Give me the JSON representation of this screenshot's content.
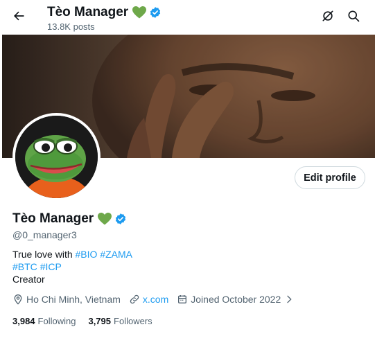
{
  "header": {
    "name": "Tèo Manager",
    "posts_count": "13.8K posts"
  },
  "profile": {
    "display_name": "Tèo Manager",
    "handle": "@0_manager3",
    "edit_label": "Edit profile",
    "bio_prefix": "True love with ",
    "bio_tags_line1": [
      "#BIO",
      "#ZAMA"
    ],
    "bio_tags_line2": [
      "#BTC",
      "#ICP"
    ],
    "bio_last_line": "Creator",
    "location": "Ho Chi Minh, Vietnam",
    "website": "x.com",
    "joined": "Joined October 2022",
    "following_count": "3,984",
    "following_label": "Following",
    "followers_count": "3,795",
    "followers_label": "Followers"
  },
  "colors": {
    "accent": "#1d9bf0",
    "heart": "#6ea84a",
    "secondary_text": "#536471"
  },
  "icons": [
    "back-arrow-icon",
    "grok-icon",
    "search-icon",
    "green-heart-icon",
    "verified-badge-icon",
    "location-pin-icon",
    "link-icon",
    "calendar-icon",
    "chevron-right-icon"
  ]
}
